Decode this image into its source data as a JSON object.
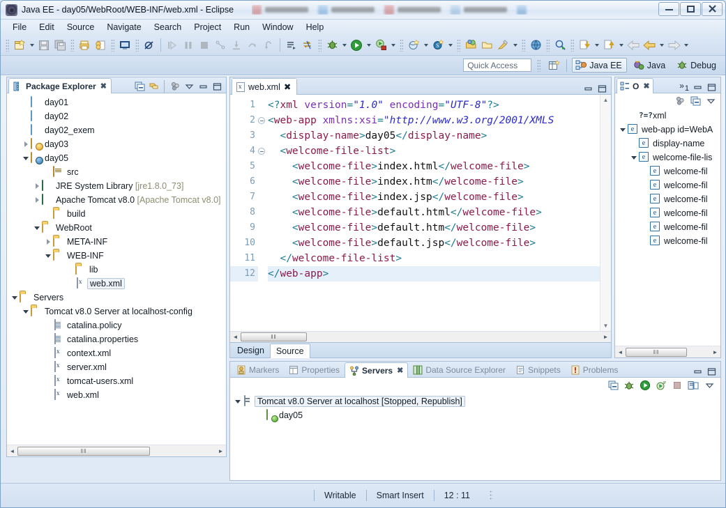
{
  "window": {
    "title": "Java EE - day05/WebRoot/WEB-INF/web.xml - Eclipse",
    "minimize_label": "–",
    "restore_label": "❐",
    "close_label": "✕"
  },
  "menubar": [
    "File",
    "Edit",
    "Source",
    "Navigate",
    "Search",
    "Project",
    "Run",
    "Window",
    "Help"
  ],
  "perspective": {
    "quick_access_placeholder": "Quick Access",
    "open_perspective_icon": "open-perspective-icon",
    "items": [
      {
        "label": "Java EE",
        "active": true
      },
      {
        "label": "Java",
        "active": false
      },
      {
        "label": "Debug",
        "active": false
      }
    ]
  },
  "package_explorer": {
    "tab_label": "Package Explorer",
    "close_label": "✖",
    "tools": [
      "collapse-all-icon",
      "link-with-editor-icon",
      "view-menu-icon",
      "minimize-icon",
      "maximize-icon"
    ],
    "tree": [
      {
        "label": "day01",
        "indent": 1,
        "twisty": "none",
        "icon": "folder-blue"
      },
      {
        "label": "day02",
        "indent": 1,
        "twisty": "none",
        "icon": "folder-blue"
      },
      {
        "label": "day02_exem",
        "indent": 1,
        "twisty": "none",
        "icon": "folder-blue"
      },
      {
        "label": "day03",
        "indent": 1,
        "twisty": "collapsed",
        "icon": "project-warn"
      },
      {
        "label": "day05",
        "indent": 1,
        "twisty": "expanded",
        "icon": "project"
      },
      {
        "label": "src",
        "indent": 3,
        "twisty": "none",
        "icon": "source-folder"
      },
      {
        "label": "JRE System Library ",
        "dim": "[jre1.8.0_73]",
        "indent": 2,
        "twisty": "collapsed",
        "icon": "library"
      },
      {
        "label": "Apache Tomcat v8.0 ",
        "dim": "[Apache Tomcat v8.0]",
        "indent": 2,
        "twisty": "collapsed",
        "icon": "library"
      },
      {
        "label": "build",
        "indent": 3,
        "twisty": "none",
        "icon": "folder"
      },
      {
        "label": "WebRoot",
        "indent": 2,
        "twisty": "expanded",
        "icon": "folder"
      },
      {
        "label": "META-INF",
        "indent": 3,
        "twisty": "collapsed",
        "icon": "folder"
      },
      {
        "label": "WEB-INF",
        "indent": 3,
        "twisty": "expanded",
        "icon": "folder"
      },
      {
        "label": "lib",
        "indent": 5,
        "twisty": "none",
        "icon": "folder"
      },
      {
        "label": "web.xml",
        "indent": 5,
        "twisty": "none",
        "icon": "xml-file",
        "selected": true
      },
      {
        "label": "Servers",
        "indent": 0,
        "twisty": "expanded",
        "icon": "folder"
      },
      {
        "label": "Tomcat v8.0 Server at localhost-config",
        "indent": 1,
        "twisty": "expanded",
        "icon": "folder"
      },
      {
        "label": "catalina.policy",
        "indent": 3,
        "twisty": "none",
        "icon": "text-file"
      },
      {
        "label": "catalina.properties",
        "indent": 3,
        "twisty": "none",
        "icon": "text-file"
      },
      {
        "label": "context.xml",
        "indent": 3,
        "twisty": "none",
        "icon": "xml-file"
      },
      {
        "label": "server.xml",
        "indent": 3,
        "twisty": "none",
        "icon": "xml-file"
      },
      {
        "label": "tomcat-users.xml",
        "indent": 3,
        "twisty": "none",
        "icon": "xml-file"
      },
      {
        "label": "web.xml",
        "indent": 3,
        "twisty": "none",
        "icon": "xml-file"
      }
    ]
  },
  "editor": {
    "tab_label": "web.xml",
    "tab_close": "✖",
    "minimize_label": "minimize-icon",
    "maximize_label": "maximize-icon",
    "bottom_tabs": [
      {
        "label": "Design",
        "active": false
      },
      {
        "label": "Source",
        "active": true
      }
    ],
    "cursor_line": 12,
    "lines": [
      {
        "n": 1,
        "fold": false,
        "tokens": [
          {
            "t": "tg",
            "v": "<?"
          },
          {
            "t": "tn",
            "v": "xml"
          },
          {
            "t": "tx",
            "v": " "
          },
          {
            "t": "at",
            "v": "version"
          },
          {
            "t": "tg",
            "v": "="
          },
          {
            "t": "av",
            "v": "\"1.0\""
          },
          {
            "t": "tx",
            "v": " "
          },
          {
            "t": "at",
            "v": "encoding"
          },
          {
            "t": "tg",
            "v": "="
          },
          {
            "t": "av",
            "v": "\"UTF-8\""
          },
          {
            "t": "tg",
            "v": "?>"
          }
        ]
      },
      {
        "n": 2,
        "fold": true,
        "tokens": [
          {
            "t": "tg",
            "v": "<"
          },
          {
            "t": "tn",
            "v": "web-app"
          },
          {
            "t": "tx",
            "v": " "
          },
          {
            "t": "at",
            "v": "xmlns:xsi"
          },
          {
            "t": "tg",
            "v": "="
          },
          {
            "t": "av",
            "v": "\"http://www.w3.org/2001/XMLS"
          }
        ]
      },
      {
        "n": 3,
        "fold": false,
        "tokens": [
          {
            "t": "tx",
            "v": "  "
          },
          {
            "t": "tg",
            "v": "<"
          },
          {
            "t": "tn",
            "v": "display-name"
          },
          {
            "t": "tg",
            "v": ">"
          },
          {
            "t": "tx",
            "v": "day05"
          },
          {
            "t": "tg",
            "v": "</"
          },
          {
            "t": "tn",
            "v": "display-name"
          },
          {
            "t": "tg",
            "v": ">"
          }
        ]
      },
      {
        "n": 4,
        "fold": true,
        "tokens": [
          {
            "t": "tx",
            "v": "  "
          },
          {
            "t": "tg",
            "v": "<"
          },
          {
            "t": "tn",
            "v": "welcome-file-list"
          },
          {
            "t": "tg",
            "v": ">"
          }
        ]
      },
      {
        "n": 5,
        "fold": false,
        "tokens": [
          {
            "t": "tx",
            "v": "    "
          },
          {
            "t": "tg",
            "v": "<"
          },
          {
            "t": "tn",
            "v": "welcome-file"
          },
          {
            "t": "tg",
            "v": ">"
          },
          {
            "t": "tx",
            "v": "index.html"
          },
          {
            "t": "tg",
            "v": "</"
          },
          {
            "t": "tn",
            "v": "welcome-file"
          },
          {
            "t": "tg",
            "v": ">"
          }
        ]
      },
      {
        "n": 6,
        "fold": false,
        "tokens": [
          {
            "t": "tx",
            "v": "    "
          },
          {
            "t": "tg",
            "v": "<"
          },
          {
            "t": "tn",
            "v": "welcome-file"
          },
          {
            "t": "tg",
            "v": ">"
          },
          {
            "t": "tx",
            "v": "index.htm"
          },
          {
            "t": "tg",
            "v": "</"
          },
          {
            "t": "tn",
            "v": "welcome-file"
          },
          {
            "t": "tg",
            "v": ">"
          }
        ]
      },
      {
        "n": 7,
        "fold": false,
        "tokens": [
          {
            "t": "tx",
            "v": "    "
          },
          {
            "t": "tg",
            "v": "<"
          },
          {
            "t": "tn",
            "v": "welcome-file"
          },
          {
            "t": "tg",
            "v": ">"
          },
          {
            "t": "tx",
            "v": "index.jsp"
          },
          {
            "t": "tg",
            "v": "</"
          },
          {
            "t": "tn",
            "v": "welcome-file"
          },
          {
            "t": "tg",
            "v": ">"
          }
        ]
      },
      {
        "n": 8,
        "fold": false,
        "tokens": [
          {
            "t": "tx",
            "v": "    "
          },
          {
            "t": "tg",
            "v": "<"
          },
          {
            "t": "tn",
            "v": "welcome-file"
          },
          {
            "t": "tg",
            "v": ">"
          },
          {
            "t": "tx",
            "v": "default.html"
          },
          {
            "t": "tg",
            "v": "</"
          },
          {
            "t": "tn",
            "v": "welcome-file"
          },
          {
            "t": "tg",
            "v": ">"
          }
        ]
      },
      {
        "n": 9,
        "fold": false,
        "tokens": [
          {
            "t": "tx",
            "v": "    "
          },
          {
            "t": "tg",
            "v": "<"
          },
          {
            "t": "tn",
            "v": "welcome-file"
          },
          {
            "t": "tg",
            "v": ">"
          },
          {
            "t": "tx",
            "v": "default.htm"
          },
          {
            "t": "tg",
            "v": "</"
          },
          {
            "t": "tn",
            "v": "welcome-file"
          },
          {
            "t": "tg",
            "v": ">"
          }
        ]
      },
      {
        "n": 10,
        "fold": false,
        "tokens": [
          {
            "t": "tx",
            "v": "    "
          },
          {
            "t": "tg",
            "v": "<"
          },
          {
            "t": "tn",
            "v": "welcome-file"
          },
          {
            "t": "tg",
            "v": ">"
          },
          {
            "t": "tx",
            "v": "default.jsp"
          },
          {
            "t": "tg",
            "v": "</"
          },
          {
            "t": "tn",
            "v": "welcome-file"
          },
          {
            "t": "tg",
            "v": ">"
          }
        ]
      },
      {
        "n": 11,
        "fold": false,
        "tokens": [
          {
            "t": "tx",
            "v": "  "
          },
          {
            "t": "tg",
            "v": "</"
          },
          {
            "t": "tn",
            "v": "welcome-file-list"
          },
          {
            "t": "tg",
            "v": ">"
          }
        ]
      },
      {
        "n": 12,
        "fold": false,
        "cur": true,
        "tokens": [
          {
            "t": "tg",
            "v": "</"
          },
          {
            "t": "tn",
            "v": "web-app"
          },
          {
            "t": "tg",
            "v": ">"
          }
        ]
      }
    ]
  },
  "outline": {
    "tab_label": "O",
    "tab_close": "✖",
    "overflow_label": "»",
    "overflow_count": "1",
    "tools": [
      "sort-icon",
      "collapse-all-icon",
      "view-menu-icon"
    ],
    "tree": [
      {
        "label": "xml",
        "indent": 1,
        "twisty": "none",
        "icon": "processing-instruction"
      },
      {
        "label": "web-app id=WebA",
        "indent": 0,
        "twisty": "expanded",
        "icon": "element"
      },
      {
        "label": "display-name",
        "indent": 1,
        "twisty": "none",
        "icon": "element"
      },
      {
        "label": "welcome-file-lis",
        "indent": 1,
        "twisty": "expanded",
        "icon": "element"
      },
      {
        "label": "welcome-fil",
        "indent": 2,
        "twisty": "none",
        "icon": "element"
      },
      {
        "label": "welcome-fil",
        "indent": 2,
        "twisty": "none",
        "icon": "element"
      },
      {
        "label": "welcome-fil",
        "indent": 2,
        "twisty": "none",
        "icon": "element"
      },
      {
        "label": "welcome-fil",
        "indent": 2,
        "twisty": "none",
        "icon": "element"
      },
      {
        "label": "welcome-fil",
        "indent": 2,
        "twisty": "none",
        "icon": "element"
      },
      {
        "label": "welcome-fil",
        "indent": 2,
        "twisty": "none",
        "icon": "element"
      }
    ]
  },
  "bottom_panel": {
    "tabs": [
      {
        "label": "Markers",
        "active": false,
        "icon": "markers-icon"
      },
      {
        "label": "Properties",
        "active": false,
        "icon": "properties-icon"
      },
      {
        "label": "Servers",
        "active": true,
        "icon": "servers-icon"
      },
      {
        "label": "Data Source Explorer",
        "active": false,
        "icon": "datasource-icon"
      },
      {
        "label": "Snippets",
        "active": false,
        "icon": "snippets-icon"
      },
      {
        "label": "Problems",
        "active": false,
        "icon": "problems-icon"
      }
    ],
    "tab_close": "✖",
    "toolbar_icons": [
      "new-server-icon",
      "debug-server-icon",
      "start-server-icon",
      "profile-server-icon",
      "stop-server-icon",
      "publish-icon",
      "view-menu-icon"
    ],
    "tree": [
      {
        "label": "Tomcat v8.0 Server at localhost  [Stopped, Republish]",
        "indent": 0,
        "twisty": "expanded",
        "icon": "server",
        "selected": true
      },
      {
        "label": "day05",
        "indent": 2,
        "twisty": "none",
        "icon": "module"
      }
    ]
  },
  "statusbar": {
    "writable": "Writable",
    "insert_mode": "Smart Insert",
    "position": "12 : 11"
  },
  "scroll": {
    "thumb_grip": "‖‖",
    "left_arrow": "◄",
    "right_arrow": "►",
    "up_arrow": "▲",
    "down_arrow": "▼"
  },
  "colors": {
    "accent": "#2a5d9f",
    "tag_delimiter": "#1a7a93",
    "tag_name": "#8b1a4a",
    "attribute": "#7b2fb5",
    "value": "#2a2ad0",
    "selection": "#e6f0fb"
  }
}
